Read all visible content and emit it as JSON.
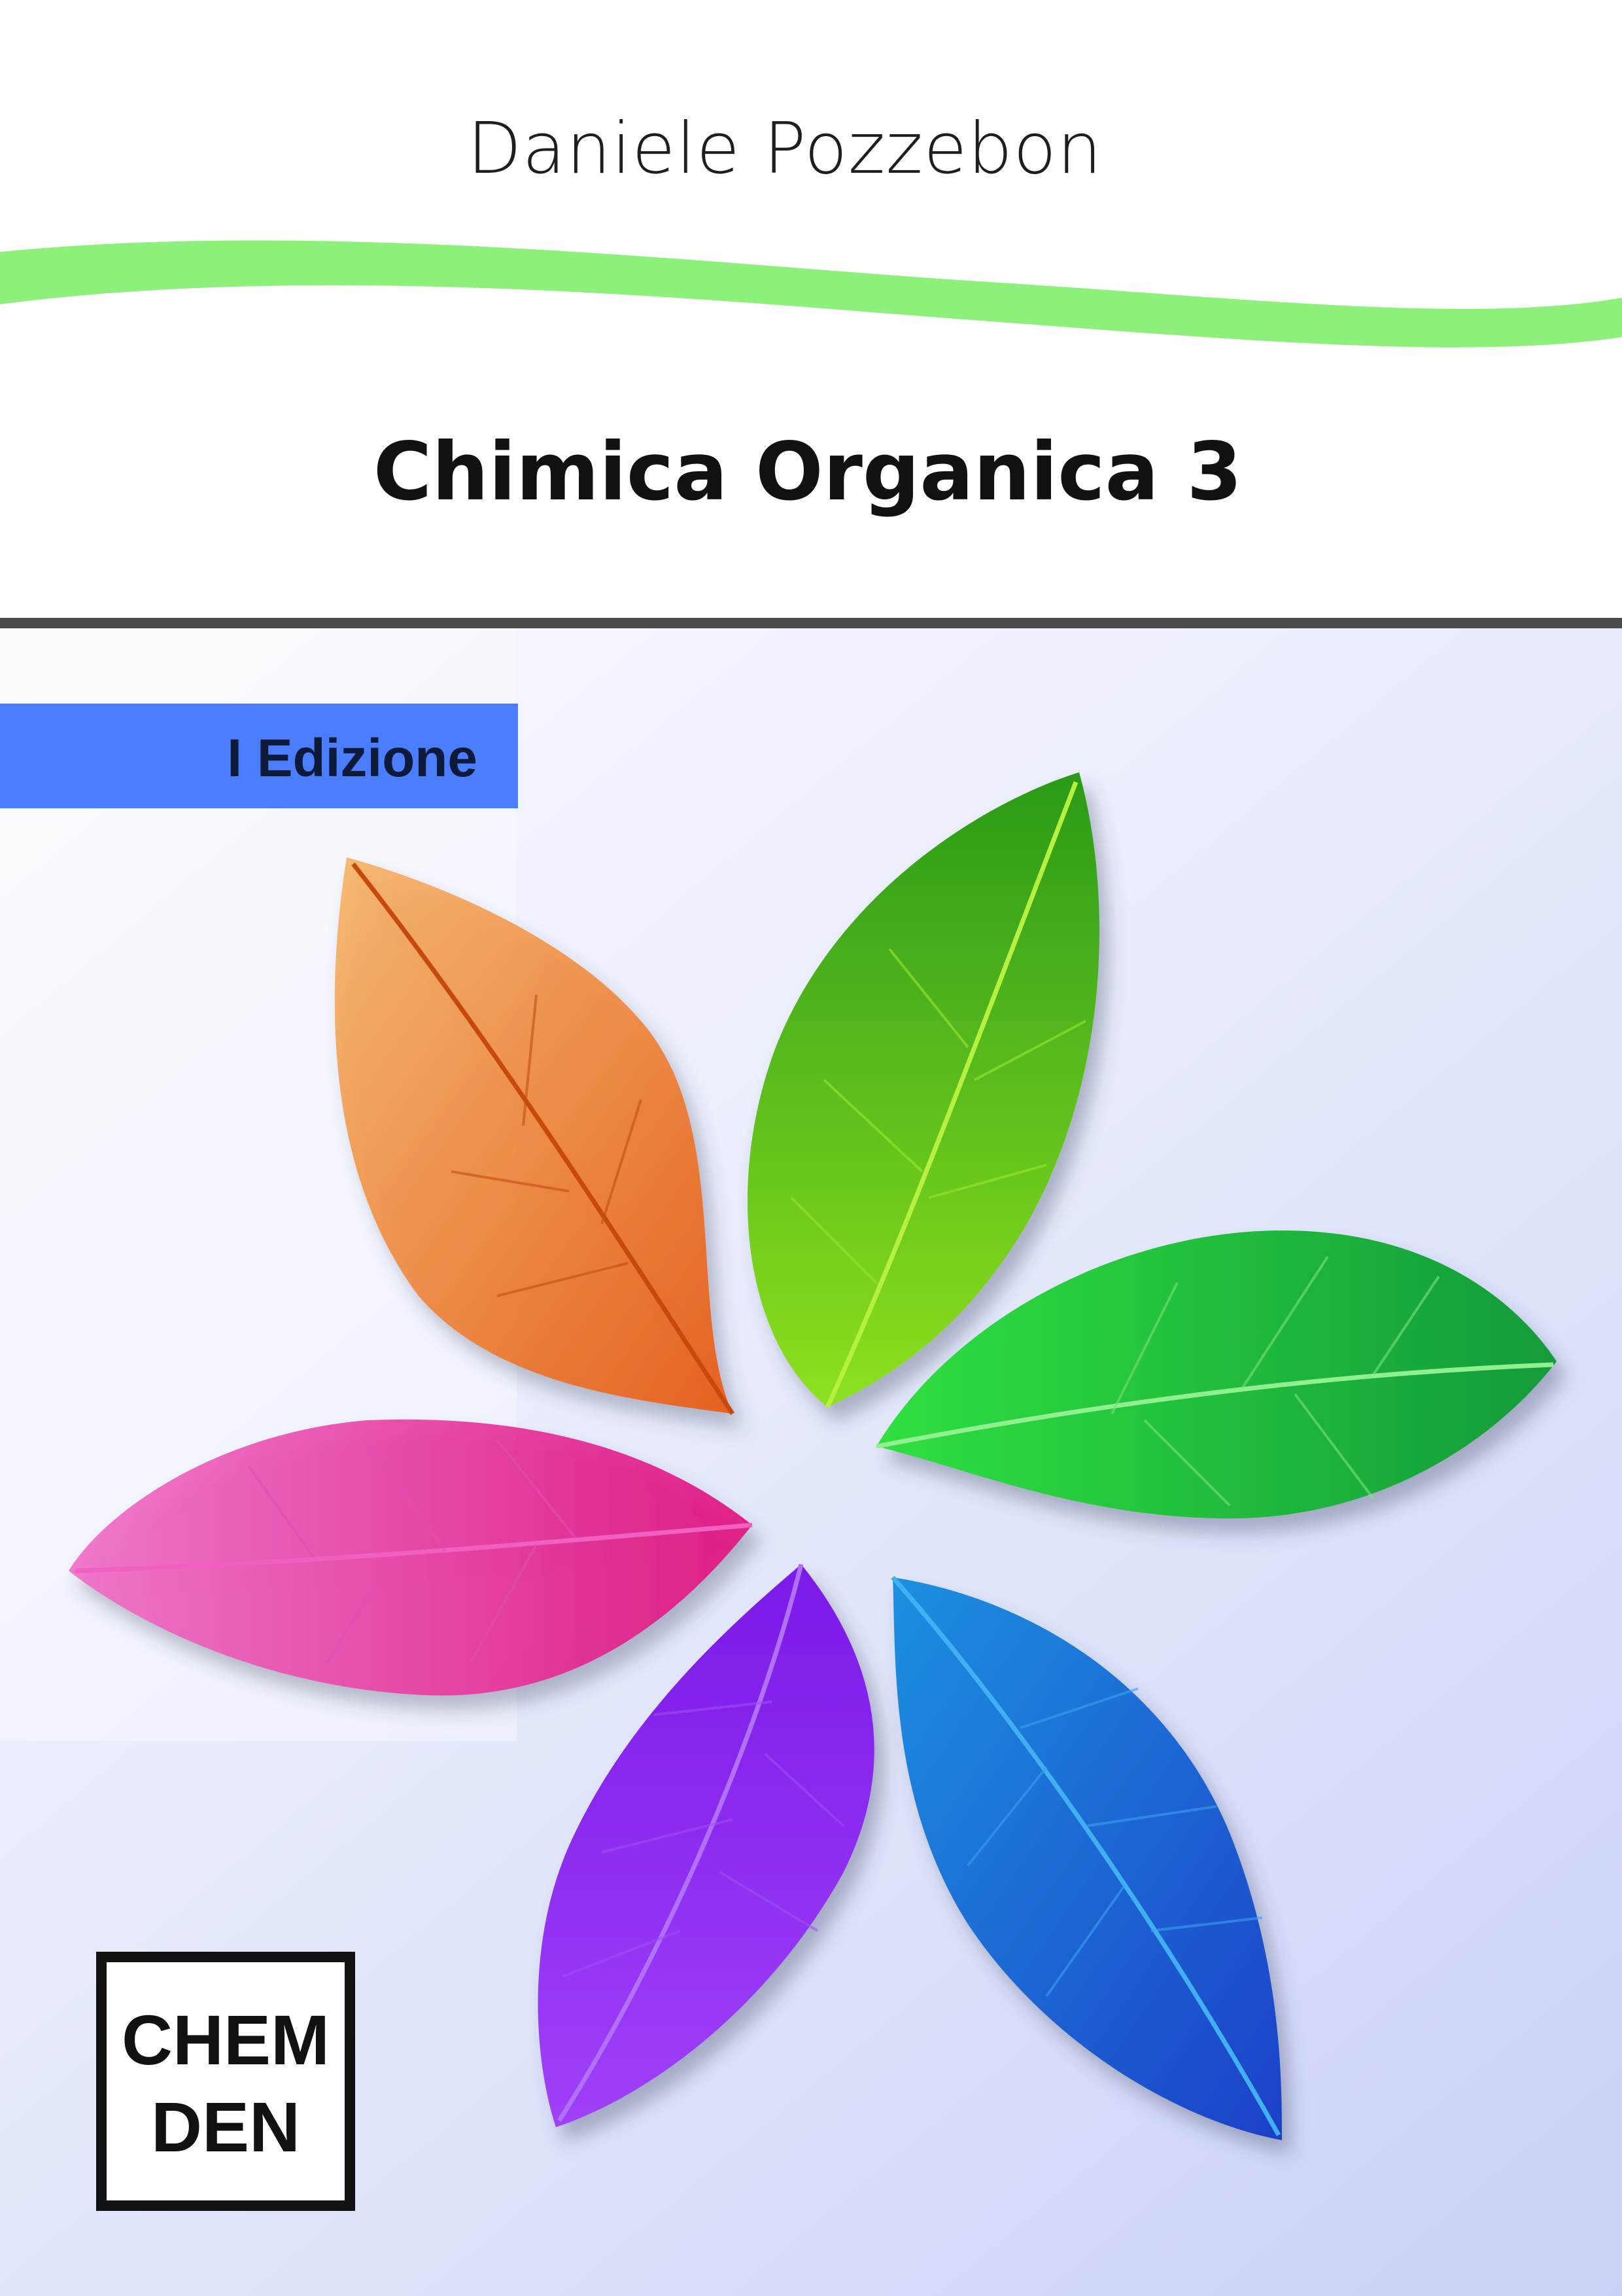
{
  "cover": {
    "author": "Daniele Pozzebon",
    "title": "Chimica Organica 3",
    "edition": "I Edizione",
    "logo": {
      "line1": "CHEM",
      "line2": "DEN"
    }
  },
  "colors": {
    "wave": "#8cf07a",
    "divider": "#4a4a4a",
    "edition_band": "#4a7dff",
    "leaves": [
      "#f07a20",
      "#5ac41a",
      "#2ecc40",
      "#1a6de0",
      "#8a20f0",
      "#f020a8"
    ]
  },
  "icons": {
    "leaves": [
      "orange-leaf-icon",
      "green-leaf-icon",
      "emerald-leaf-icon",
      "blue-leaf-icon",
      "purple-leaf-icon",
      "pink-leaf-icon"
    ]
  }
}
